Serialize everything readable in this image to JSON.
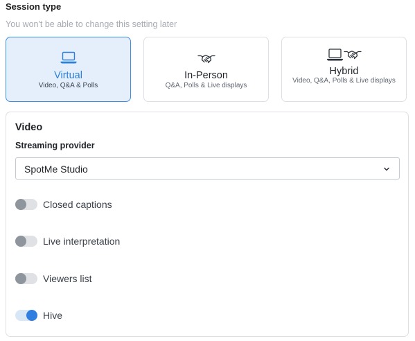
{
  "session_type": {
    "title": "Session type",
    "hint": "You won't be able to change this setting later",
    "options": [
      {
        "label": "Virtual",
        "sub": "Video, Q&A & Polls",
        "icon": "laptop-icon",
        "selected": true
      },
      {
        "label": "In-Person",
        "sub": "Q&A, Polls & Live displays",
        "icon": "handshake-icon",
        "selected": false
      },
      {
        "label": "Hybrid",
        "sub": "Video, Q&A, Polls & Live displays",
        "icon": "laptop-handshake-icon",
        "selected": false
      }
    ]
  },
  "video": {
    "title": "Video",
    "provider_label": "Streaming provider",
    "provider_value": "SpotMe Studio",
    "toggles": [
      {
        "label": "Closed captions",
        "on": false
      },
      {
        "label": "Live interpretation",
        "on": false
      },
      {
        "label": "Viewers list",
        "on": false
      },
      {
        "label": "Hive",
        "on": true
      }
    ]
  },
  "colors": {
    "accent": "#2f7ee0",
    "selected_bg": "#e4effb",
    "selected_border": "#3d8fe6",
    "toggle_off_knob": "#8e959d"
  }
}
